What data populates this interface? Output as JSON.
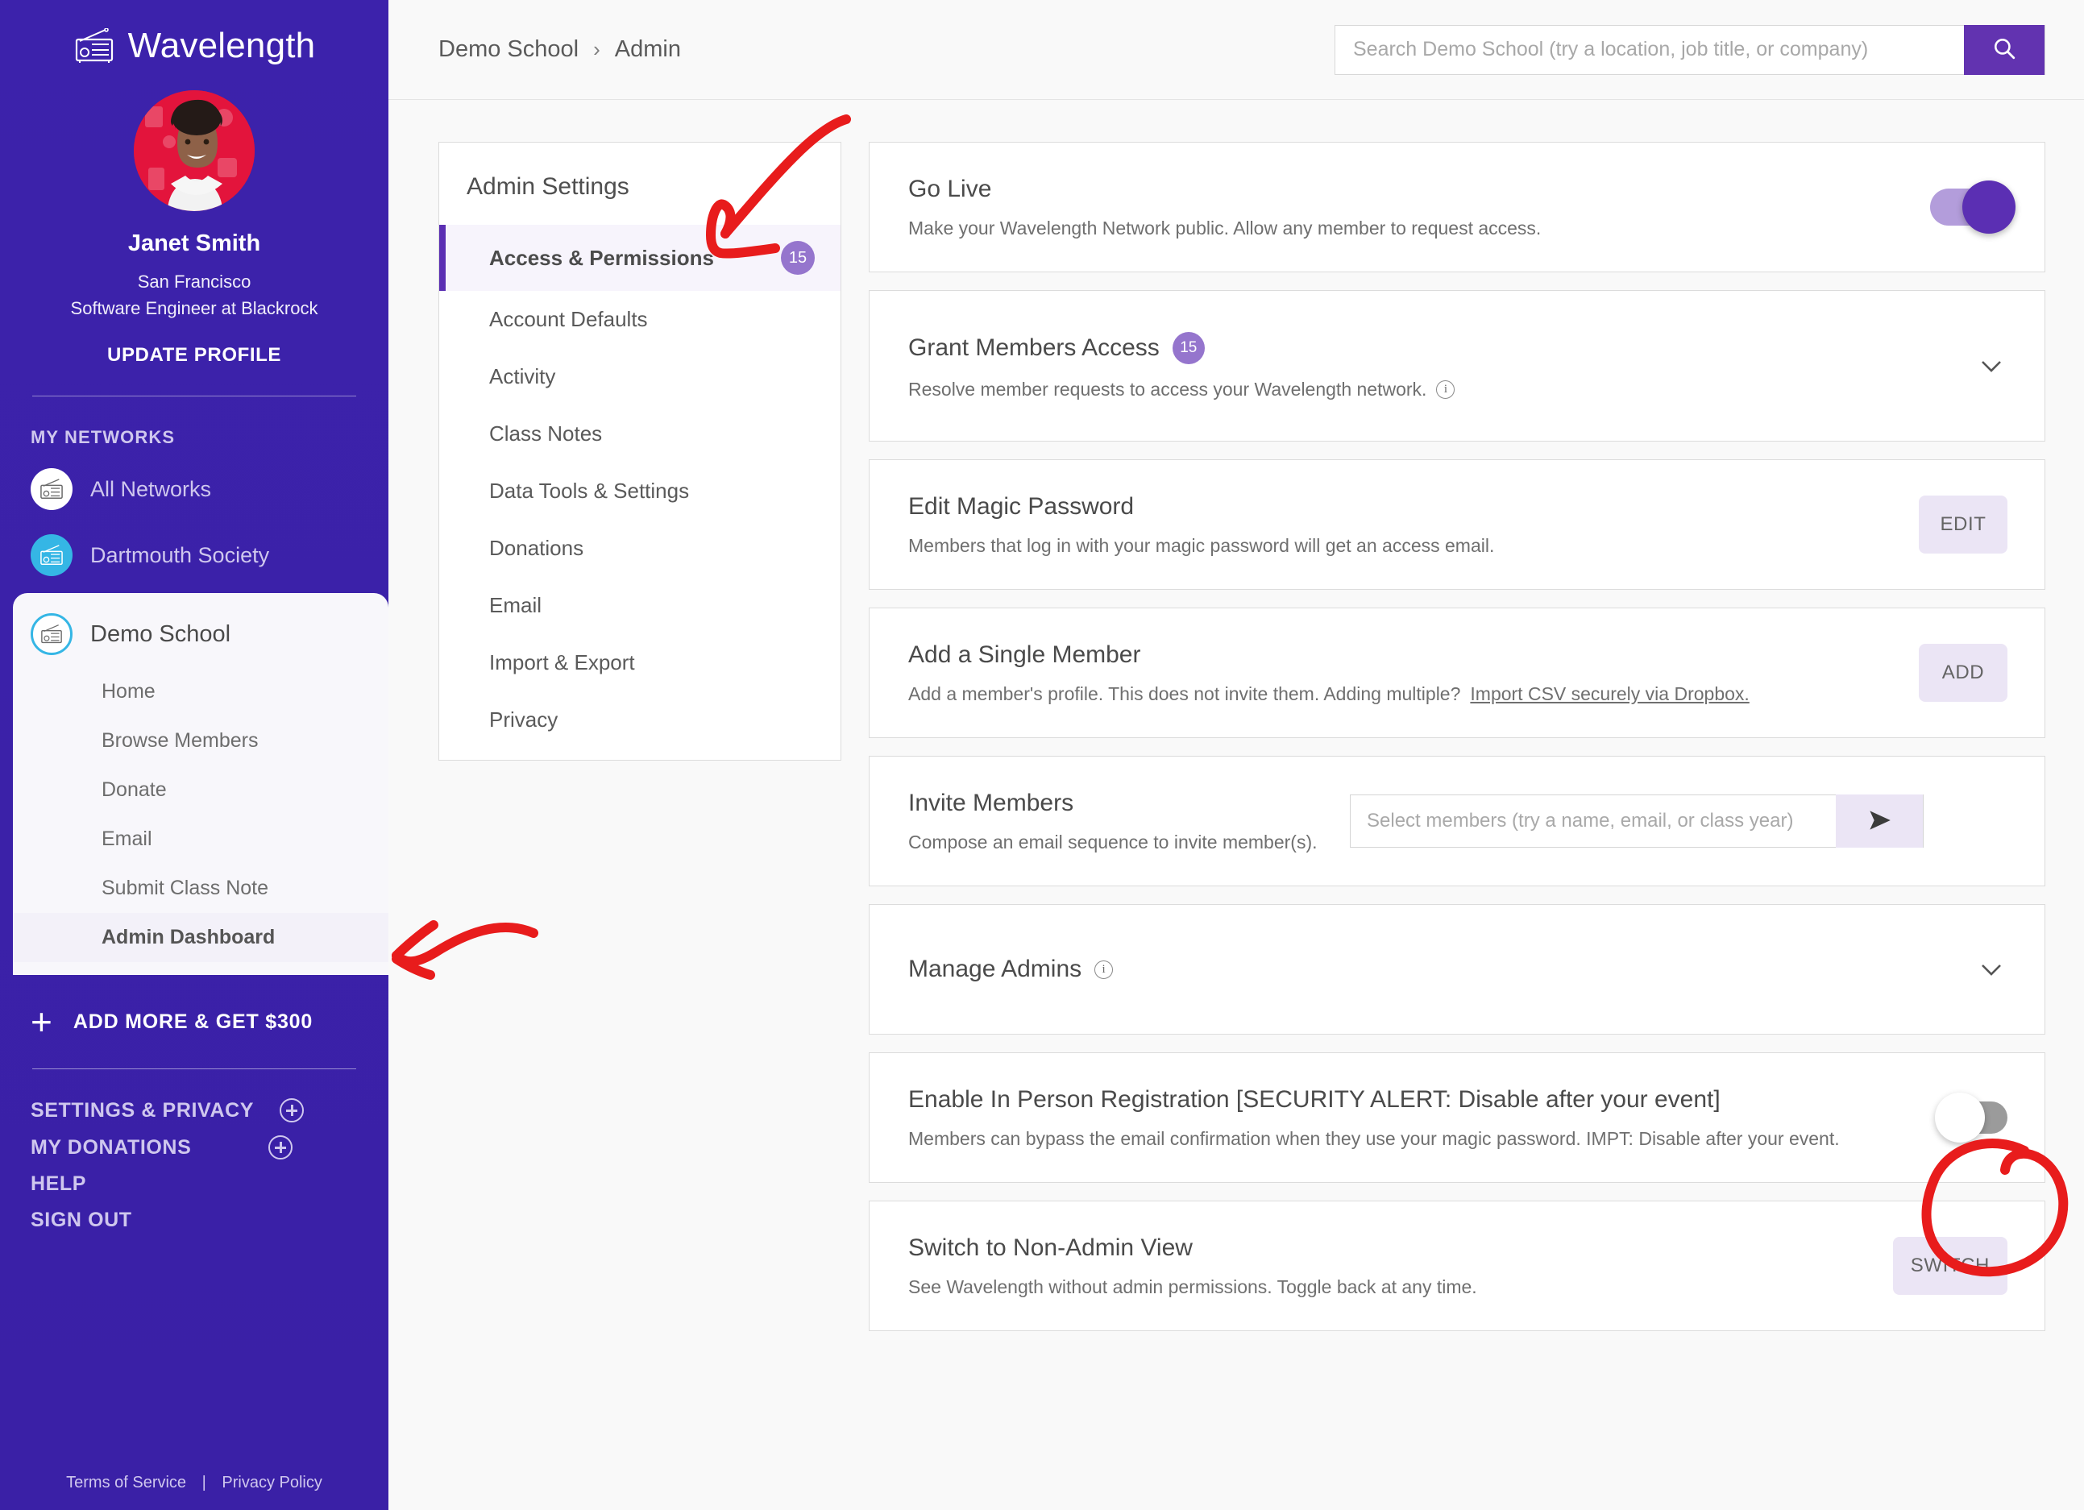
{
  "sidebar": {
    "brand": {
      "name": "Wavelength",
      "logo_icon": "radio-icon"
    },
    "profile": {
      "name": "Janet Smith",
      "location": "San Francisco",
      "title": "Software Engineer at Blackrock",
      "update_label": "UPDATE PROFILE"
    },
    "networks_header": "MY NETWORKS",
    "networks": [
      {
        "label": "All Networks",
        "icon": "radio-icon"
      },
      {
        "label": "Dartmouth Society",
        "icon": "radio-icon"
      }
    ],
    "active_network": {
      "label": "Demo School",
      "icon": "radio-icon"
    },
    "active_network_items": [
      {
        "label": "Home",
        "active": false
      },
      {
        "label": "Browse Members",
        "active": false
      },
      {
        "label": "Donate",
        "active": false
      },
      {
        "label": "Email",
        "active": false
      },
      {
        "label": "Submit Class Note",
        "active": false
      },
      {
        "label": "Admin Dashboard",
        "active": true
      }
    ],
    "add_more": {
      "label": "ADD MORE & GET $300",
      "icon": "plus-icon"
    },
    "footer_links": [
      {
        "label": "SETTINGS & PRIVACY",
        "has_plus": true
      },
      {
        "label": "MY DONATIONS",
        "has_plus": true
      },
      {
        "label": "HELP",
        "has_plus": false
      },
      {
        "label": "SIGN OUT",
        "has_plus": false
      }
    ],
    "legal": {
      "terms": "Terms of Service",
      "separator": "|",
      "privacy": "Privacy Policy"
    }
  },
  "topbar": {
    "breadcrumb": {
      "root": "Demo School",
      "chevron": "›",
      "current": "Admin"
    },
    "search": {
      "placeholder": "Search Demo School (try a location, job title, or company)",
      "value": "",
      "button_icon": "search-icon"
    }
  },
  "settings_panel": {
    "title": "Admin Settings",
    "items": [
      {
        "label": "Access & Permissions",
        "badge": "15",
        "active": true
      },
      {
        "label": "Account Defaults",
        "badge": "",
        "active": false
      },
      {
        "label": "Activity",
        "badge": "",
        "active": false
      },
      {
        "label": "Class Notes",
        "badge": "",
        "active": false
      },
      {
        "label": "Data Tools & Settings",
        "badge": "",
        "active": false
      },
      {
        "label": "Donations",
        "badge": "",
        "active": false
      },
      {
        "label": "Email",
        "badge": "",
        "active": false
      },
      {
        "label": "Import & Export",
        "badge": "",
        "active": false
      },
      {
        "label": "Privacy",
        "badge": "",
        "active": false
      }
    ]
  },
  "cards": {
    "go_live": {
      "title": "Go Live",
      "desc": "Make your Wavelength Network public. Allow any member to request access.",
      "toggle_state": "on"
    },
    "grant_access": {
      "title": "Grant Members Access",
      "badge": "15",
      "desc": "Resolve member requests to access your Wavelength network.",
      "info_icon": "info-icon",
      "expand_icon": "chevron-down-icon"
    },
    "magic_password": {
      "title": "Edit Magic Password",
      "desc": "Members that log in with your magic password will get an access email.",
      "button_label": "EDIT"
    },
    "add_member": {
      "title": "Add a Single Member",
      "desc_before": "Add a member's profile. This does not invite them. Adding multiple?",
      "link_label": "Import CSV securely via Dropbox.",
      "button_label": "ADD"
    },
    "invite_members": {
      "title": "Invite Members",
      "desc": "Compose an email sequence to invite member(s).",
      "input_placeholder": "Select members (try a name, email, or class year)",
      "input_value": "",
      "send_icon": "send-arrow-icon"
    },
    "manage_admins": {
      "title": "Manage Admins",
      "info_icon": "info-icon",
      "expand_icon": "chevron-down-icon"
    },
    "in_person_registration": {
      "title": "Enable In Person Registration [SECURITY ALERT: Disable after your event]",
      "desc": "Members can bypass the email confirmation when they use your magic password. IMPT: Disable after your event.",
      "toggle_state": "off"
    },
    "non_admin_view": {
      "title": "Switch to Non-Admin View",
      "desc": "See Wavelength without admin permissions. Toggle back at any time.",
      "button_label": "SWITCH"
    }
  },
  "annotations": {
    "arrow_to_access_permissions": "red-arrow-icon",
    "arrow_to_admin_dashboard": "red-arrow-icon",
    "circle_on_registration_toggle": "red-circle-icon"
  },
  "colors": {
    "sidebar_bg": "#3a21a8",
    "accent": "#5b2fb3",
    "badge": "#9575cd",
    "button_bg": "#ebe5f5",
    "annotation_red": "#e81c1c"
  }
}
